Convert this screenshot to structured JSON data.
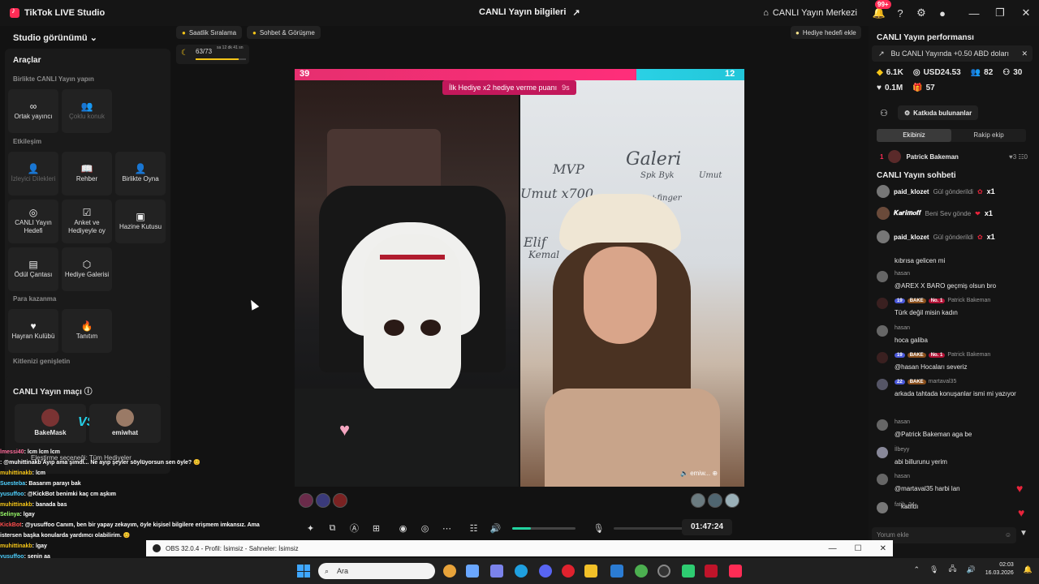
{
  "titlebar": {
    "app_title": "TikTok LIVE Studio",
    "center_title": "CANLI Yayın bilgileri",
    "live_center": "CANLI Yayın Merkezi",
    "notif_badge": "99+"
  },
  "left": {
    "studio_view": "Studio görünümü",
    "tools_title": "Araçlar",
    "section_together": "Birlikte CANLI Yayın yapın",
    "section_engage": "Etkileşim",
    "section_money": "Para kazanma",
    "section_audience": "Kitlenizi genişletin",
    "tiles": [
      {
        "label": "Ortak yayıncı",
        "icon": "link-icon",
        "glyph": "∞"
      },
      {
        "label": "Çoklu konuk",
        "icon": "multi-guest-icon",
        "glyph": "👥"
      },
      {
        "label": "İzleyici Dilekleri",
        "icon": "viewer-wishes-icon",
        "glyph": "👤"
      },
      {
        "label": "Rehber",
        "icon": "guide-icon",
        "glyph": "📖"
      },
      {
        "label": "Birlikte Oyna",
        "icon": "play-together-icon",
        "glyph": "👤"
      },
      {
        "label": "CANLI Yayın Hedefi",
        "icon": "target-icon",
        "glyph": "◎"
      },
      {
        "label": "Anket ve Hediyeyle oy",
        "icon": "poll-icon",
        "glyph": "☑"
      },
      {
        "label": "Hazine Kutusu",
        "icon": "treasure-icon",
        "glyph": "▣"
      },
      {
        "label": "Ödül Çantası",
        "icon": "reward-bag-icon",
        "glyph": "▤"
      },
      {
        "label": "Hediye Galerisi",
        "icon": "gift-gallery-icon",
        "glyph": "⬡"
      },
      {
        "label": "Hayran Kulübü",
        "icon": "fan-club-icon",
        "glyph": "♥"
      },
      {
        "label": "Tanıtım",
        "icon": "promote-icon",
        "glyph": "🔥"
      }
    ],
    "match_title": "CANLI Yayın maçı",
    "match_left": "BakeMask",
    "match_vs": "VS",
    "match_right": "emiwhat"
  },
  "overlay_chat": {
    "filter_label": "Eleştirme seçeneği: Tüm Hediyeler",
    "lines": [
      {
        "user": "lmessi40",
        "text": ": lcm lcm lcm",
        "color": "#ff6b9a"
      },
      {
        "user": "",
        "text": ": @muhittinakb Ayıp ama şimdi... Ne ayıp şeyler söylüyorsun sen öyle? 😊",
        "color": "#ff6b9a"
      },
      {
        "user": "muhittinakb",
        "text": ": lcm",
        "color": "#f5c518"
      },
      {
        "user": "Suesteba",
        "text": ": Basarım parayı bak",
        "color": "#4fd1ff"
      },
      {
        "user": "yusuffoo",
        "text": ": @KickBot benimki kaç cm aşkım",
        "color": "#4fd1ff"
      },
      {
        "user": "muhittinakb",
        "text": ": banada bas",
        "color": "#f5c518"
      },
      {
        "user": "Selinya",
        "text": ": lgay",
        "color": "#9bff6b"
      },
      {
        "user": "KickBot",
        "text": ": @yusuffoo Canım, ben bir yapay zekayım, öyle kişisel bilgilere erişmem imkansız. Ama",
        "color": "#ff4d4d"
      },
      {
        "user": "",
        "text": "istersen başka konularda yardımcı olabilirim. 😊",
        "color": "#ffffff"
      },
      {
        "user": "muhittinakb",
        "text": ": lgay",
        "color": "#f5c518"
      },
      {
        "user": "yusuffoo",
        "text": ": senin aa",
        "color": "#4fd1ff"
      },
      {
        "user": "Suesteba",
        "text": ": 500 lira var",
        "color": "#4fd1ff"
      },
      {
        "user": "lmessi40",
        "text": ": lcm",
        "color": "#ff6b9a"
      }
    ]
  },
  "top": {
    "chip_hourly": "Saatlik Sıralama",
    "chip_chat": "Sohbet & Görüşme",
    "progress": "63/73",
    "progress_sub": "sa 12 dk 41 sn",
    "progress_fraction": 0.86,
    "goal": "Hediye hedefi ekle"
  },
  "battle": {
    "score_left": "39",
    "score_right": "12",
    "left_share": 0.76,
    "banner": "İlk Hediye x2 hediye verme puanı",
    "banner_secs": "9s",
    "right_user": "emiw...",
    "whiteboard": [
      "MVP",
      "Galeri",
      "Umut x700",
      "Spk Byk",
      "Umut",
      "Elif",
      "Kemal",
      "+finger"
    ]
  },
  "controls": {
    "timer": "01:47:24",
    "volume": 0.3
  },
  "right": {
    "perf_title": "CANLI Yayın performansı",
    "earn_text": "Bu CANLI Yayında +0.50 ABD doları",
    "stats": [
      "6.1K",
      "USD24.53",
      "82",
      "30"
    ],
    "stats2": [
      "0.1M",
      "57"
    ],
    "contrib": "Katkıda bulunanlar",
    "tab_ours": "Ekibiniz",
    "tab_rival": "Rakip ekip",
    "rank_num": "1",
    "rank_name": "Patrick Bakeman",
    "rank_hearts": "♥3  ☷0",
    "chat_title": "CANLI Yayın sohbeti",
    "gifts": [
      {
        "user": "paid_klozet",
        "text": "Gül gönderildi",
        "count": "x1"
      },
      {
        "user": "𝑲𝒂𝒓𝒊𝒎𝒐𝒇𝒇",
        "text": "Beni Sev gönde",
        "count": "x1"
      },
      {
        "user": "paid_klozet",
        "text": "Gül gönderildi",
        "count": "x1"
      }
    ],
    "messages": [
      {
        "name": "",
        "text": "kıbrısa gelicen mi",
        "badges": []
      },
      {
        "name": "hasan",
        "text": "@AREX X BARO geçmiş olsun bro",
        "badges": []
      },
      {
        "name": "Patrick Bakeman",
        "text": "Türk değil misin kadın",
        "badges": [
          "19",
          "BAKE",
          "No. 1"
        ]
      },
      {
        "name": "hasan",
        "text": "hoca galiba",
        "badges": []
      },
      {
        "name": "Patrick Bakeman",
        "text": "@hasan Hocaları severiz",
        "badges": [
          "19",
          "BAKE",
          "No. 1"
        ]
      },
      {
        "name": "martaval35",
        "text": "arkada tahtada konuşanlar ismi mi yazıyor",
        "badges": [
          "22",
          "BAKE"
        ]
      },
      {
        "name": "hasan",
        "text": "@Patrick Bakeman aga be",
        "badges": []
      },
      {
        "name": "İlbeyy",
        "text": "abi billurunu yerim",
        "badges": []
      },
      {
        "name": "hasan",
        "text": "@martaval35 harbi lan",
        "badges": []
      },
      {
        "name": "fatih_34",
        "text": "katıldı",
        "badges": []
      }
    ],
    "comment_placeholder": "Yorum ekle"
  },
  "obs": {
    "title": "OBS 32.0.4 - Profil: İsimsiz - Sahneler: İsimsiz"
  },
  "taskbar": {
    "search_placeholder": "Ara",
    "time": "02:03",
    "date": "16.03.2026"
  }
}
